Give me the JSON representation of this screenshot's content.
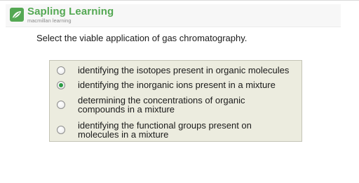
{
  "header": {
    "brand_name": "Sapling Learning",
    "brand_tagline": "macmillan learning",
    "logo_icon": "sapling-leaf-logo",
    "brand_color": "#54a853"
  },
  "question": {
    "text": "Select the viable application of gas chromatography."
  },
  "options": [
    {
      "label": "identifying the isotopes present in organic molecules",
      "selected": false
    },
    {
      "label": "identifying the inorganic ions present in a mixture",
      "selected": true
    },
    {
      "label": "determining the concentrations of organic\ncompounds in a mixture",
      "selected": false
    },
    {
      "label": "identifying the functional groups present on\nmolecules in a mixture",
      "selected": false
    }
  ],
  "colors": {
    "options_background": "#ececdf",
    "radio_selected": "#2c9c45"
  }
}
